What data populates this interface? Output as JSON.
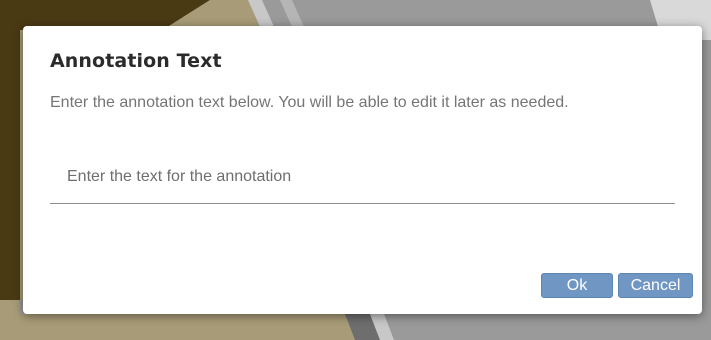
{
  "dialog": {
    "title": "Annotation Text",
    "description": "Enter the annotation text below. You will be able to edit it later as needed.",
    "input": {
      "placeholder": "Enter the text for the annotation",
      "value": ""
    },
    "buttons": {
      "ok_label": "Ok",
      "cancel_label": "Cancel"
    }
  },
  "colors": {
    "button_fill": "#7097c4",
    "button_border": "#5e86b3",
    "title_text": "#2b2b2b",
    "description_text": "#757575",
    "backdrop_dark": "#4a3a14",
    "backdrop_tan": "#a89c78",
    "backdrop_gray": "#9a9a9a"
  }
}
